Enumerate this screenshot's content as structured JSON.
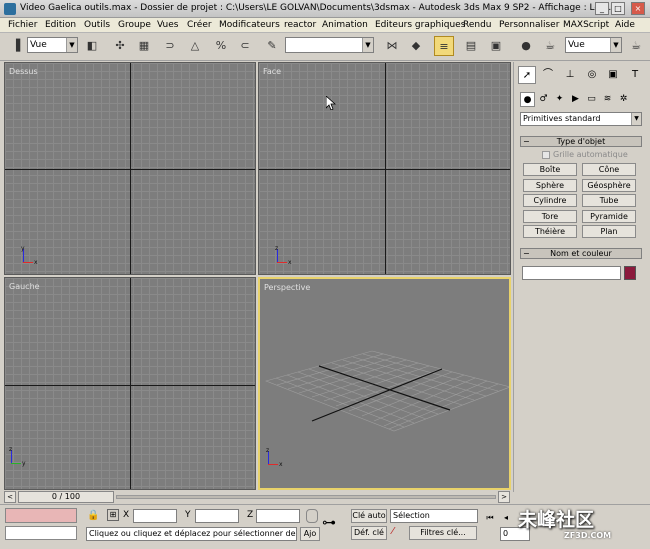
{
  "window": {
    "title": "Video Gaelica outils.max    - Dossier de projet : C:\\Users\\LE GOLVAN\\Documents\\3dsmax    - Autodesk 3ds Max 9 SP2    - Affichage : Log...",
    "buttons": {
      "minimize": "_",
      "maximize": "□",
      "close": "×"
    }
  },
  "menu": [
    "Fichier",
    "Edition",
    "Outils",
    "Groupe",
    "Vues",
    "Créer",
    "Modificateurs",
    "reactor",
    "Animation",
    "Editeurs graphiques",
    "Rendu",
    "Personnaliser",
    "MAXScript",
    "Aide"
  ],
  "toolbar": {
    "coord_system_left": "Vue",
    "named_selection": "",
    "coord_system_right": "Vue"
  },
  "viewports": {
    "top": "Dessus",
    "front": "Face",
    "left": "Gauche",
    "perspective": "Perspective",
    "axis_x": "x",
    "axis_y": "y",
    "axis_z": "z"
  },
  "command_panel": {
    "category_dropdown": "Primitives standard",
    "object_type_rollout": "Type d'objet",
    "autogrid_label": "Grille automatique",
    "primitives": [
      "Boîte",
      "Cône",
      "Sphère",
      "Géosphère",
      "Cylindre",
      "Tube",
      "Tore",
      "Pyramide",
      "Théière",
      "Plan"
    ],
    "name_color_rollout": "Nom et couleur",
    "object_name": "",
    "object_color": "#8b1a3c"
  },
  "time_slider": {
    "frame_display": "0 / 100",
    "prev": "<",
    "next": ">"
  },
  "status": {
    "x_label": "X",
    "y_label": "Y",
    "z_label": "Z",
    "x_value": "",
    "y_value": "",
    "z_value": "",
    "prompt": "Cliquez ou cliquez et déplacez pour sélectionner des o",
    "add_time_tag": "Ajo",
    "auto_key": "Clé auto",
    "set_key": "Déf. clé",
    "selection_dropdown": "Sélection",
    "key_filters": "Filtres clé...",
    "frame_field": "0"
  },
  "watermark": {
    "text": "未峰社区",
    "sub": "ZF3D.COM"
  }
}
